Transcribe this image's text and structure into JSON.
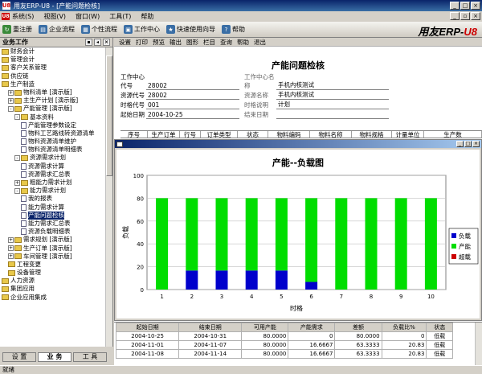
{
  "window": {
    "title": "用友ERP-U8 - [产能问题检核]",
    "logo": "U8"
  },
  "menu": {
    "items": [
      "系统(S)",
      "视图(V)",
      "窗口(W)",
      "工具(T)",
      "帮助"
    ]
  },
  "toolbar": {
    "items": [
      {
        "label": "重注册",
        "icon": "login-icon",
        "color": "#3a8a3a"
      },
      {
        "label": "企业流程",
        "icon": "flow-icon",
        "color": "#3a6ea5"
      },
      {
        "label": "个性流程",
        "icon": "custom-flow-icon",
        "color": "#3a6ea5"
      },
      {
        "label": "工作中心",
        "icon": "workcenter-icon",
        "color": "#3a6ea5"
      },
      {
        "label": "快速使用向导",
        "icon": "wizard-icon",
        "color": "#3a6ea5"
      },
      {
        "label": "帮助",
        "icon": "help-icon",
        "color": "#3a6ea5"
      }
    ],
    "brand_text": "用友ERP-",
    "brand_em": "U8"
  },
  "left_panel": {
    "title": "业务工作",
    "tree": [
      {
        "label": "财务会计",
        "indent": 0,
        "type": "folder"
      },
      {
        "label": "管理会计",
        "indent": 0,
        "type": "folder"
      },
      {
        "label": "客户关系管理",
        "indent": 0,
        "type": "folder"
      },
      {
        "label": "供应链",
        "indent": 0,
        "type": "folder"
      },
      {
        "label": "生产制造",
        "indent": 0,
        "type": "folder"
      },
      {
        "label": "物料清单 [演示版]",
        "indent": 1,
        "type": "folder",
        "pm": "+"
      },
      {
        "label": "主生产计划 [演示版]",
        "indent": 1,
        "type": "folder",
        "pm": "+"
      },
      {
        "label": "产能管理 [演示版]",
        "indent": 1,
        "type": "folder",
        "pm": "-"
      },
      {
        "label": "基本资料",
        "indent": 2,
        "type": "folder",
        "pm": "-"
      },
      {
        "label": "产能管理参数设定",
        "indent": 3,
        "type": "doc"
      },
      {
        "label": "物料工艺路线转资源清单",
        "indent": 3,
        "type": "doc"
      },
      {
        "label": "物料资源清单维护",
        "indent": 3,
        "type": "doc"
      },
      {
        "label": "物料资源清单明细表",
        "indent": 3,
        "type": "doc"
      },
      {
        "label": "资源需求计划",
        "indent": 2,
        "type": "folder",
        "pm": "-"
      },
      {
        "label": "资源需求计算",
        "indent": 3,
        "type": "doc"
      },
      {
        "label": "资源需求汇总表",
        "indent": 3,
        "type": "doc"
      },
      {
        "label": "粗能力需求计划",
        "indent": 2,
        "type": "folder",
        "pm": "+"
      },
      {
        "label": "能力需求计划",
        "indent": 2,
        "type": "folder",
        "pm": "-"
      },
      {
        "label": "我的报表",
        "indent": 3,
        "type": "doc"
      },
      {
        "label": "能力需求计算",
        "indent": 3,
        "type": "doc"
      },
      {
        "label": "产能问题检核",
        "indent": 3,
        "type": "doc",
        "selected": true
      },
      {
        "label": "能力需求汇总表",
        "indent": 3,
        "type": "doc"
      },
      {
        "label": "资源负载明细表",
        "indent": 3,
        "type": "doc"
      },
      {
        "label": "需求规划 [演示版]",
        "indent": 1,
        "type": "folder",
        "pm": "+"
      },
      {
        "label": "生产订单 [演示版]",
        "indent": 1,
        "type": "folder",
        "pm": "+"
      },
      {
        "label": "车间管理 [演示版]",
        "indent": 1,
        "type": "folder",
        "pm": "+"
      },
      {
        "label": "工程变更",
        "indent": 1,
        "type": "folder"
      },
      {
        "label": "设备管理",
        "indent": 1,
        "type": "folder"
      },
      {
        "label": "人力资源",
        "indent": 0,
        "type": "folder"
      },
      {
        "label": "集团应用",
        "indent": 0,
        "type": "folder"
      },
      {
        "label": "企业应用集成",
        "indent": 0,
        "type": "folder"
      }
    ],
    "tabs": [
      "设 置",
      "业 务",
      "工 具"
    ]
  },
  "report": {
    "toolbar": [
      "设置",
      "打印",
      "预览",
      "输出",
      "图形",
      "栏目",
      "查询",
      "帮助",
      "退出"
    ],
    "title": "产能问题检核",
    "fields": [
      {
        "label": "工作中心代号",
        "value": "28002",
        "label2": "工作中心名称",
        "value2": "手机内核测试"
      },
      {
        "label": "资源代号",
        "value": "28002",
        "label2": "资源名称",
        "value2": "手机内核测试"
      },
      {
        "label": "时格代号",
        "value": "001",
        "label2": "时格说明",
        "value2": "计划"
      },
      {
        "label": "起始日期",
        "value": "2004-10-25",
        "label2": "结束日期",
        "value2": ""
      }
    ],
    "columns": [
      "序号",
      "生产订单",
      "行号",
      "订单类型",
      "状态",
      "物料编码",
      "物料名称",
      "物料规格",
      "计量单位",
      "生产数"
    ]
  },
  "chart_data": {
    "type": "bar",
    "title": "产能--负载图",
    "xlabel": "时格",
    "ylabel": "负载",
    "categories": [
      "1",
      "2",
      "3",
      "4",
      "5",
      "6",
      "7",
      "8",
      "9",
      "10"
    ],
    "series": [
      {
        "name": "负载",
        "color": "#0000cc",
        "values": [
          0,
          16.67,
          16.67,
          16.67,
          16.67,
          6.67,
          0,
          0,
          0,
          0
        ]
      },
      {
        "name": "产能",
        "color": "#00dd00",
        "values": [
          80,
          63.33,
          63.33,
          63.33,
          63.33,
          73.33,
          80,
          80,
          80,
          80
        ]
      },
      {
        "name": "超载",
        "color": "#cc0000",
        "values": [
          0,
          0,
          0,
          0,
          0,
          0,
          0,
          0,
          0,
          0
        ]
      }
    ],
    "stacked": true,
    "ylim": [
      0,
      100
    ],
    "yticks": [
      0,
      20,
      40,
      60,
      80,
      100
    ],
    "legend": "right",
    "grid": true
  },
  "grid": {
    "columns": [
      "起始日期",
      "结束日期",
      "可用产能",
      "产能需求",
      "差额",
      "负载比%",
      "状态"
    ],
    "rows": [
      [
        "2004-10-25",
        "2004-10-31",
        "80.0000",
        "0",
        "80.0000",
        "0",
        "低载"
      ],
      [
        "2004-11-01",
        "2004-11-07",
        "80.0000",
        "16.6667",
        "63.3333",
        "20.83",
        "低载"
      ],
      [
        "2004-11-08",
        "2004-11-14",
        "80.0000",
        "16.6667",
        "63.3333",
        "20.83",
        "低载"
      ]
    ]
  },
  "status": {
    "text": "就绪"
  }
}
